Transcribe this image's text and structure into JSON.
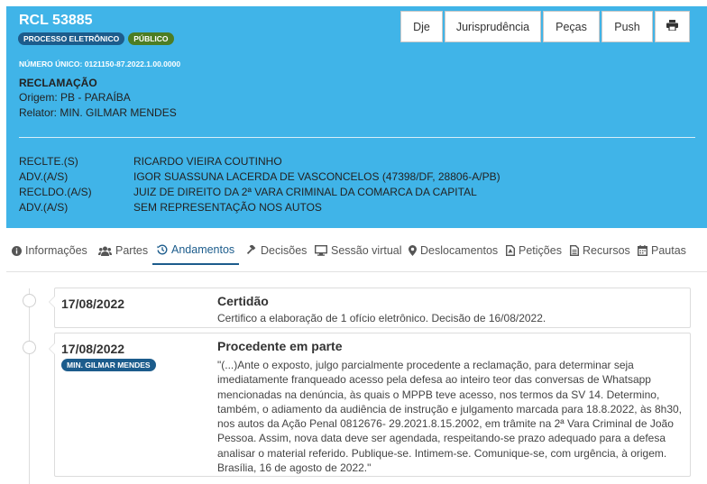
{
  "process": {
    "title": "RCL 53885",
    "badges": {
      "electronic": "PROCESSO ELETRÔNICO",
      "public": "PÚBLICO"
    },
    "numero_unico": "NÚMERO ÚNICO: 0121150-87.2022.1.00.0000",
    "classe": "RECLAMAÇÃO",
    "origem": "Origem: PB - PARAÍBA",
    "relator": "Relator: MIN. GILMAR MENDES"
  },
  "header_buttons": {
    "dje": "Dje",
    "jurisprudencia": "Jurisprudência",
    "pecas": "Peças",
    "push": "Push",
    "print_icon": "printer-icon"
  },
  "parties": [
    {
      "label": "RECLTE.(S)",
      "value": "RICARDO VIEIRA COUTINHO"
    },
    {
      "label": "ADV.(A/S)",
      "value": "IGOR SUASSUNA LACERDA DE VASCONCELOS (47398/DF, 28806-A/PB)"
    },
    {
      "label": "RECLDO.(A/S)",
      "value": "JUIZ DE DIREITO DA 2ª VARA CRIMINAL DA COMARCA DA CAPITAL"
    },
    {
      "label": "ADV.(A/S)",
      "value": "SEM REPRESENTAÇÃO NOS AUTOS"
    }
  ],
  "tabs": [
    {
      "label": "Informações",
      "icon": "info-icon"
    },
    {
      "label": "Partes",
      "icon": "users-icon"
    },
    {
      "label": "Andamentos",
      "icon": "history-icon",
      "active": true
    },
    {
      "label": "Decisões",
      "icon": "gavel-icon"
    },
    {
      "label": "Sessão virtual",
      "icon": "monitor-icon"
    },
    {
      "label": "Deslocamentos",
      "icon": "map-marker-icon"
    },
    {
      "label": "Petições",
      "icon": "file-pdf-icon"
    },
    {
      "label": "Recursos",
      "icon": "file-text-icon"
    },
    {
      "label": "Pautas",
      "icon": "calendar-icon"
    }
  ],
  "andamentos": [
    {
      "date": "17/08/2022",
      "title": "Certidão",
      "text": "Certifico a elaboração de 1 ofício eletrônico. Decisão de 16/08/2022."
    },
    {
      "date": "17/08/2022",
      "author": "MIN. GILMAR MENDES",
      "title": "Procedente em parte",
      "text_lines": [
        "\"(...)Ante o exposto, julgo parcialmente procedente a reclamação, para determinar seja",
        "imediatamente franqueado acesso pela defesa ao inteiro teor das conversas de Whatsapp",
        "mencionadas na denúncia, às quais o MPPB teve acesso, nos termos da SV 14. Determino,",
        "também, o adiamento da audiência de instrução e julgamento marcada para 18.8.2022, às 8h30,",
        "nos autos da Ação Penal 0812676- 29.2021.8.15.2002, em trâmite na 2ª Vara Criminal de João",
        "Pessoa. Assim, nova data deve ser agendada, respeitando-se prazo adequado para a defesa",
        "analisar o material referido. Publique-se. Intimem-se. Comunique-se, com urgência, à origem.",
        "Brasília, 16 de agosto de 2022.\""
      ]
    }
  ]
}
